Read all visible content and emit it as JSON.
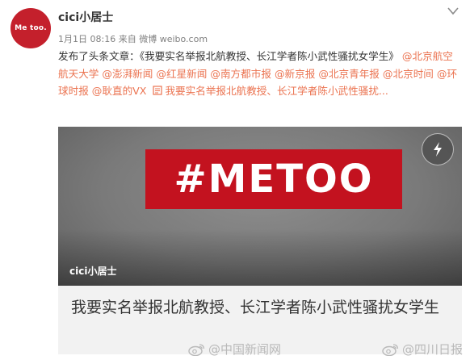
{
  "author": {
    "avatar_text": "Me too.",
    "name": "cici小居士"
  },
  "meta": {
    "date": "1月1日 08:16",
    "source_prefix": "来自",
    "source": "微博 weibo.com"
  },
  "post": {
    "intro": "发布了头条文章：《我要实名举报北航教授、长江学者陈小武性骚扰女学生》",
    "mentions": [
      "@北京航空航天大学",
      "@澎湃新闻",
      "@红星新闻",
      "@南方都市报",
      "@新京报",
      "@北京青年报",
      "@北京时间",
      "@环球时报",
      "@耿直的VX"
    ],
    "article_link": "我要实名举报北航教授、长江学者陈小武性骚扰..."
  },
  "card": {
    "banner_text": "#METOO",
    "author_overlay": "cici小居士",
    "title": "我要实名举报北航教授、长江学者陈小武性骚扰女学生"
  },
  "watermarks": [
    "@中国新闻网",
    "@四川日报"
  ],
  "colors": {
    "link": "#eb7350",
    "brand_red": "#c3121f",
    "avatar_red": "#c4202c"
  },
  "icons": [
    "chevron-down-icon",
    "article-icon",
    "flash-icon",
    "weibo-logo-icon"
  ]
}
